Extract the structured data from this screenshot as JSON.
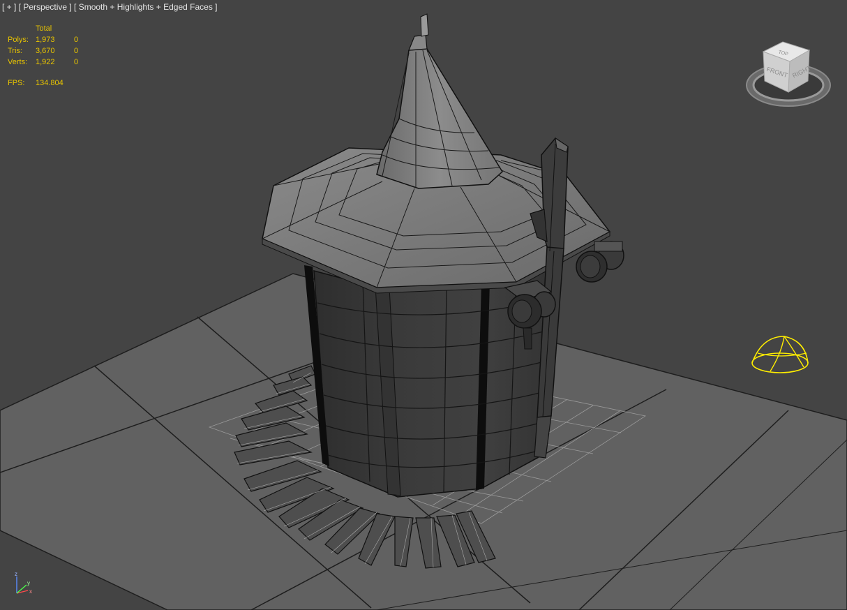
{
  "viewport": {
    "label": "[ + ] [ Perspective ] [ Smooth + Highlights + Edged Faces ]"
  },
  "stats": {
    "header": "Total",
    "rows": [
      {
        "label": "Polys:",
        "total": "1,973",
        "selected": "0"
      },
      {
        "label": "Tris:",
        "total": "3,670",
        "selected": "0"
      },
      {
        "label": "Verts:",
        "total": "1,922",
        "selected": "0"
      }
    ],
    "fps_label": "FPS:",
    "fps_value": "134.804"
  },
  "viewcube": {
    "top": "TOP",
    "front": "FRONT",
    "right": "RIGHT"
  },
  "axis": {
    "x": "x",
    "y": "y",
    "z": "z"
  },
  "colors": {
    "background": "#444444",
    "ground": "#606060",
    "stats_text": "#e8c400",
    "light_gizmo": "#ffee00"
  }
}
